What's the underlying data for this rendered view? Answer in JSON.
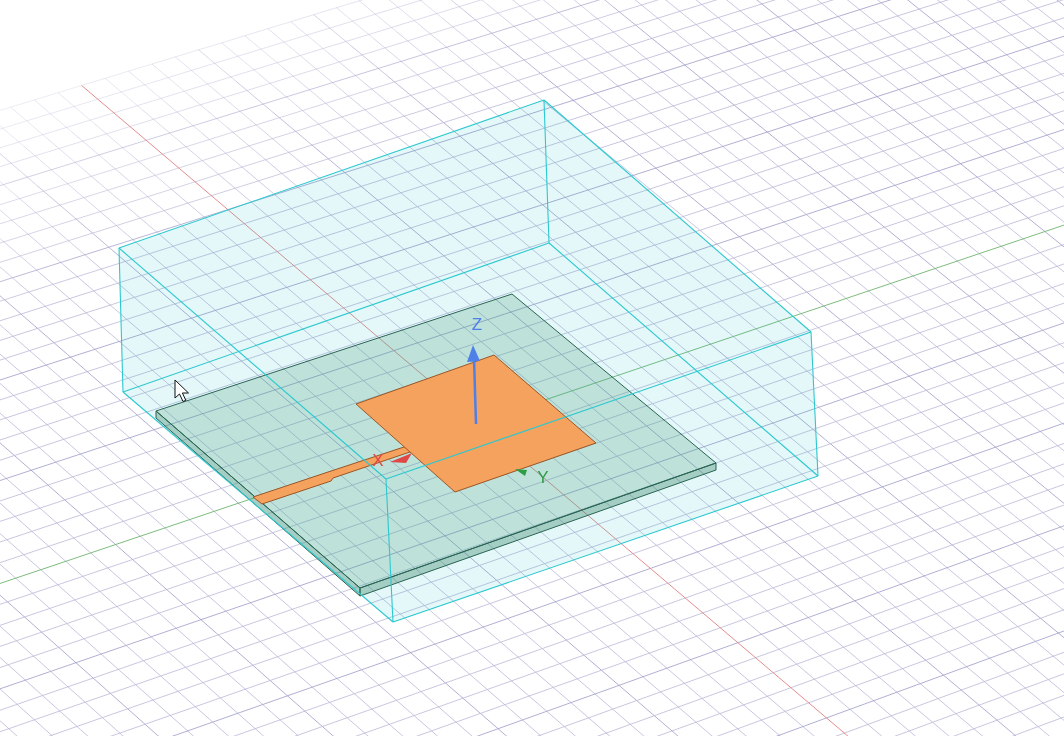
{
  "viewport": {
    "axes_triad": [
      {
        "kind": "z",
        "label": "Z",
        "color": "#4f80e8"
      },
      {
        "kind": "x",
        "label": "X",
        "color": "#e04848"
      },
      {
        "kind": "y",
        "label": "Y",
        "color": "#2e9e44"
      }
    ]
  }
}
